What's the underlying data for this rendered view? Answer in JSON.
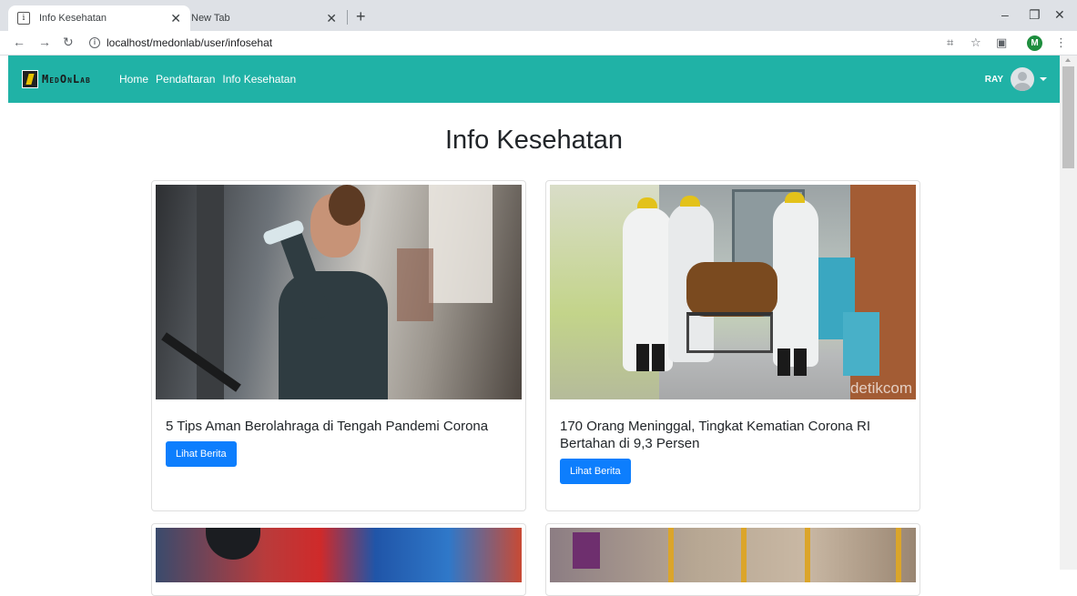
{
  "browser": {
    "tabs": [
      {
        "title": "Info Kesehatan",
        "favicon": "document-icon",
        "active": true
      },
      {
        "title": "New Tab",
        "active": false
      }
    ],
    "url": "localhost/medonlab/user/infosehat",
    "profile_initial": "M"
  },
  "navbar": {
    "brand": "MedOnLab",
    "links": [
      "Home",
      "Pendaftaran",
      "Info Kesehatan"
    ],
    "user_name": "RAY",
    "accent_color": "#20b2a6"
  },
  "page": {
    "title": "Info Kesehatan"
  },
  "articles": [
    {
      "title": "5 Tips Aman Berolahraga di Tengah Pandemi Corona",
      "button": "Lihat Berita"
    },
    {
      "title": "170 Orang Meninggal, Tingkat Kematian Corona RI Bertahan di 9,3 Persen",
      "button": "Lihat Berita",
      "image_watermark": "detikcom"
    },
    {
      "title": "",
      "button": ""
    },
    {
      "title": "",
      "button": ""
    }
  ],
  "colors": {
    "button": "#0d7efd"
  }
}
